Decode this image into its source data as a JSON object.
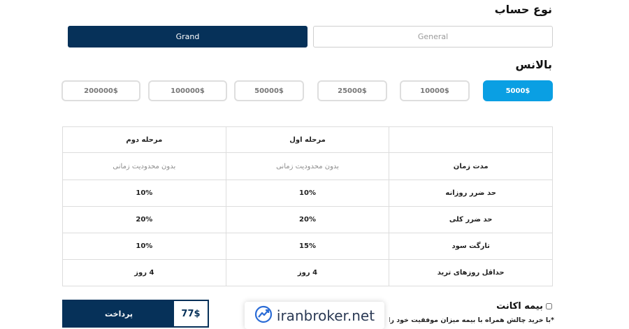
{
  "account_type": {
    "title": "نوع حساب",
    "options": [
      {
        "label": "Grand",
        "selected": true
      },
      {
        "label": "General",
        "selected": false
      }
    ]
  },
  "balance": {
    "title": "بالانس",
    "options": [
      {
        "label": "5000$",
        "selected": true
      },
      {
        "label": "10000$",
        "selected": false
      },
      {
        "label": "25000$",
        "selected": false
      },
      {
        "label": "50000$",
        "selected": false
      },
      {
        "label": "100000$",
        "selected": false
      },
      {
        "label": "200000$",
        "selected": false
      }
    ]
  },
  "table": {
    "headers": [
      "",
      "مرحله اول",
      "مرحله دوم"
    ],
    "rows": [
      {
        "label": "مدت زمان",
        "phase1": "بدون محدودیت زمانی",
        "phase2": "بدون محدودیت زمانی"
      },
      {
        "label": "حد ضرر روزانه",
        "phase1": "10%",
        "phase2": "10%"
      },
      {
        "label": "حد ضرر کلی",
        "phase1": "20%",
        "phase2": "20%"
      },
      {
        "label": "تارگت سود",
        "phase1": "15%",
        "phase2": "10%"
      },
      {
        "label": "حداقل روزهای ترید",
        "phase1": "4 روز",
        "phase2": "4 روز"
      }
    ]
  },
  "insurance": {
    "label": "بیمه اکانت",
    "checked": false,
    "note": "*با خرید چالش همراه با بیمه میزان موفقیت خود را افزایش دهید"
  },
  "checkout": {
    "price": "77$",
    "pay_label": "پرداخت"
  },
  "watermark": {
    "text": "iranbroker.net",
    "icon": "chart-trend-icon"
  },
  "colors": {
    "primary": "#063159",
    "accent": "#0a9fe3"
  }
}
